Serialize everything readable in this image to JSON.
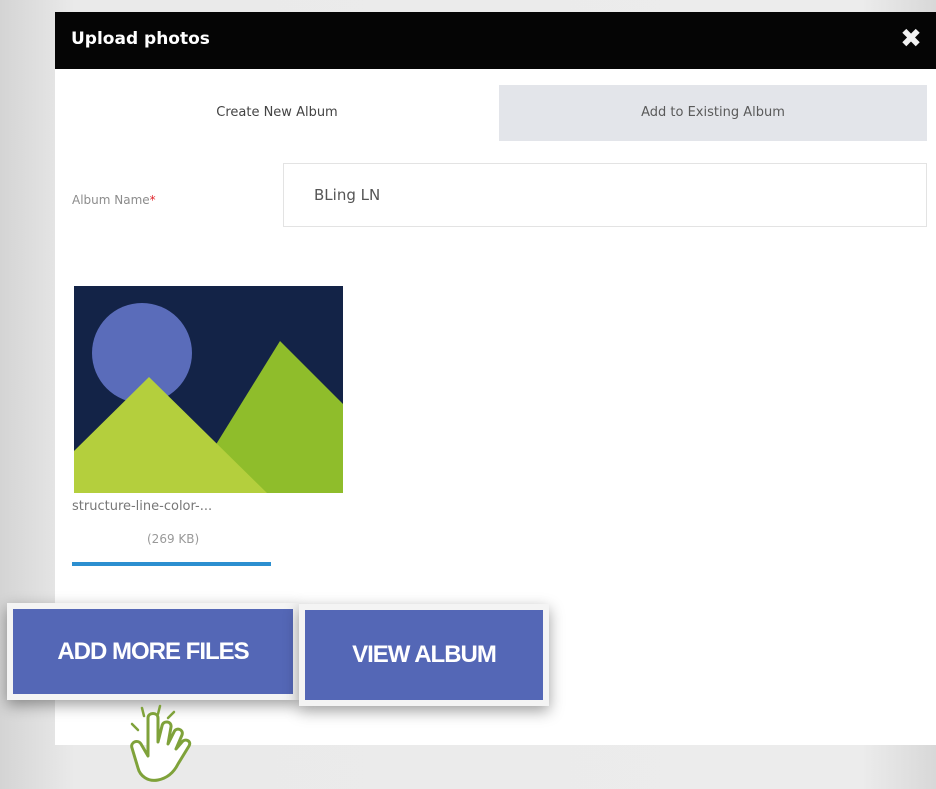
{
  "modal": {
    "title": "Upload photos"
  },
  "icons": {
    "close": "close-icon",
    "cursor": "hand-pointer-icon"
  },
  "tabs": [
    {
      "label": "Create New Album",
      "active": true
    },
    {
      "label": "Add to Existing Album",
      "active": false
    }
  ],
  "form": {
    "album_name_label": "Album Name",
    "required_marker": "*",
    "album_name_value": "BLing LN"
  },
  "upload": {
    "file_name": "structure-line-color-...",
    "file_size": "(269 KB)",
    "progress": 1.0
  },
  "buttons": {
    "add_more_files": "ADD MORE FILES",
    "view_album": "VIEW ALBUM"
  },
  "colors": {
    "header_bg": "#050505",
    "accent": "#5467b6",
    "progress": "#2c8fd0",
    "required": "#e0242b",
    "thumb_sky": "#132347",
    "thumb_sun": "#5a6cba",
    "thumb_hill_back": "#8fbd2b",
    "thumb_hill_front": "#b4cf3d"
  }
}
